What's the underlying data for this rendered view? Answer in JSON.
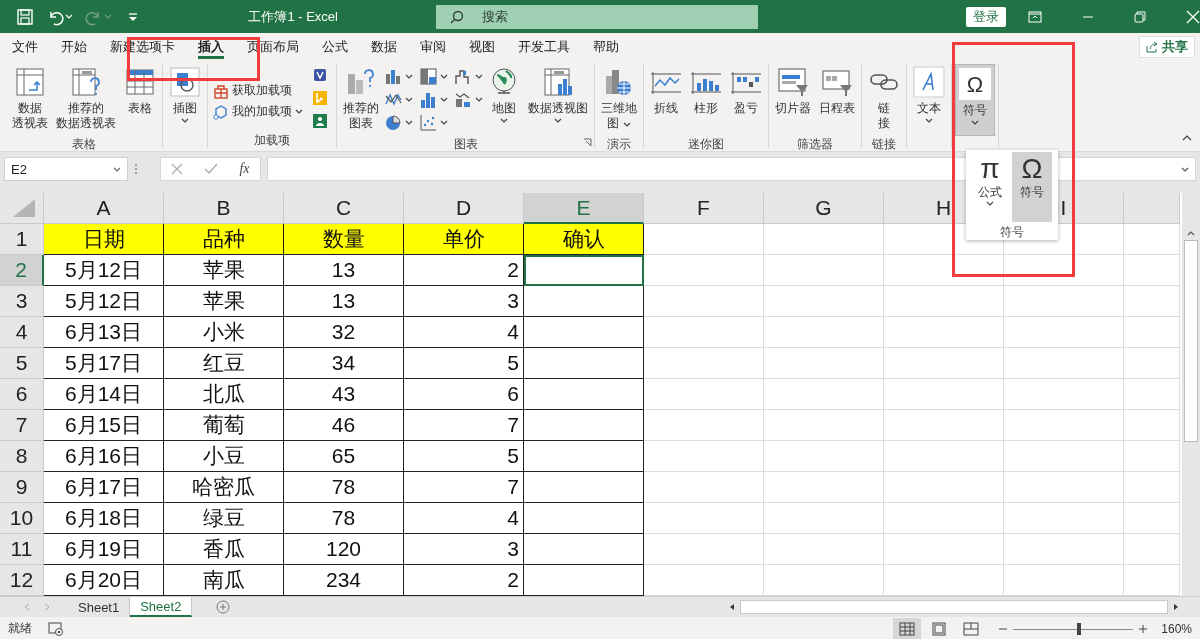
{
  "title_bar": {
    "quick_access": [
      {
        "kind": "save",
        "disabled": false
      },
      {
        "kind": "undo",
        "disabled": false
      },
      {
        "kind": "redo",
        "disabled": true
      },
      {
        "kind": "customize",
        "disabled": false
      }
    ],
    "title": "工作簿1 - Excel",
    "search": {
      "placeholder": "搜索"
    },
    "sign_in": "登录"
  },
  "tabs": [
    {
      "label": "文件",
      "selected": false
    },
    {
      "label": "开始",
      "selected": false
    },
    {
      "label": "新建选项卡",
      "selected": false
    },
    {
      "label": "插入",
      "selected": true
    },
    {
      "label": "页面布局",
      "selected": false
    },
    {
      "label": "公式",
      "selected": false
    },
    {
      "label": "数据",
      "selected": false
    },
    {
      "label": "审阅",
      "selected": false
    },
    {
      "label": "视图",
      "selected": false
    },
    {
      "label": "开发工具",
      "selected": false
    },
    {
      "label": "帮助",
      "selected": false
    }
  ],
  "share": "共享",
  "ribbon": [
    {
      "label": "表格",
      "items": [
        {
          "kind": "large",
          "lines": [
            "数据",
            "透视表"
          ]
        },
        {
          "kind": "large",
          "lines": [
            "推荐的",
            "数据透视表"
          ]
        },
        {
          "kind": "large",
          "lines": [
            "表格"
          ]
        }
      ]
    },
    {
      "items": [
        {
          "kind": "large",
          "lines": [
            "插图"
          ],
          "dropdown": true
        }
      ]
    },
    {
      "label": "加载项",
      "items": [
        {
          "kind": "small",
          "label": "获取加载项"
        },
        {
          "kind": "small",
          "label": "我的加载项",
          "dropdown": true
        },
        {
          "kind": "icon-stack"
        }
      ]
    },
    {
      "label": "图表",
      "launcher": true,
      "items": [
        {
          "kind": "large",
          "lines": [
            "推荐的",
            "图表"
          ]
        },
        {
          "kind": "gallery"
        },
        {
          "kind": "large",
          "lines": [
            "地图"
          ],
          "dropdown": true
        },
        {
          "kind": "large",
          "lines": [
            "数据透视图"
          ],
          "dropdown": true
        }
      ]
    },
    {
      "label": "演示",
      "items": [
        {
          "kind": "large",
          "lines": [
            "三维地",
            "图"
          ],
          "dropdown": true
        }
      ]
    },
    {
      "label": "迷你图",
      "items": [
        {
          "kind": "large",
          "lines": [
            "折线"
          ]
        },
        {
          "kind": "large",
          "lines": [
            "柱形"
          ]
        },
        {
          "kind": "large",
          "lines": [
            "盈亏"
          ]
        }
      ]
    },
    {
      "label": "筛选器",
      "items": [
        {
          "kind": "large",
          "lines": [
            "切片器"
          ]
        },
        {
          "kind": "large",
          "lines": [
            "日程表"
          ]
        }
      ]
    },
    {
      "label": "链接",
      "items": [
        {
          "kind": "large",
          "lines": [
            "链",
            "接"
          ]
        }
      ]
    },
    {
      "items": [
        {
          "kind": "large",
          "lines": [
            "文本"
          ],
          "dropdown": true
        }
      ]
    },
    {
      "items": [
        {
          "kind": "large",
          "lines": [
            "符号"
          ],
          "glyph": "Ω",
          "dropdown": true,
          "pressed": true
        }
      ]
    }
  ],
  "symbol_menu": {
    "items": [
      {
        "glyph": "π",
        "label": "公式",
        "dropdown": true,
        "selected": false
      },
      {
        "glyph": "Ω",
        "label": "符号",
        "selected": true
      }
    ],
    "group_label": "符号"
  },
  "formula_bar": {
    "name_box": "E2",
    "fx": "fx"
  },
  "table": {
    "columns": [
      {
        "label": "A",
        "selected": false
      },
      {
        "label": "B",
        "selected": false
      },
      {
        "label": "C",
        "selected": false
      },
      {
        "label": "D",
        "selected": false
      },
      {
        "label": "E",
        "selected": true
      },
      {
        "label": "F",
        "selected": false
      },
      {
        "label": "G",
        "selected": false
      },
      {
        "label": "H",
        "selected": false
      },
      {
        "label": "I",
        "selected": false
      }
    ],
    "rows": [
      {
        "number": "1",
        "selected": false,
        "color": "#ffff00",
        "cells": [
          "日期",
          "品种",
          "数量",
          "单价",
          "确认"
        ]
      },
      {
        "number": "2",
        "selected": true,
        "cells": [
          "5月12日",
          "苹果",
          "13",
          "2"
        ]
      },
      {
        "number": "3",
        "selected": false,
        "cells": [
          "5月12日",
          "苹果",
          "13",
          "3"
        ]
      },
      {
        "number": "4",
        "selected": false,
        "cells": [
          "6月13日",
          "小米",
          "32",
          "4"
        ]
      },
      {
        "number": "5",
        "selected": false,
        "cells": [
          "5月17日",
          "红豆",
          "34",
          "5"
        ]
      },
      {
        "number": "6",
        "selected": false,
        "cells": [
          "6月14日",
          "北瓜",
          "43",
          "6"
        ]
      },
      {
        "number": "7",
        "selected": false,
        "cells": [
          "6月15日",
          "葡萄",
          "46",
          "7"
        ]
      },
      {
        "number": "8",
        "selected": false,
        "cells": [
          "6月16日",
          "小豆",
          "65",
          "5"
        ]
      },
      {
        "number": "9",
        "selected": false,
        "cells": [
          "6月17日",
          "哈密瓜",
          "78",
          "7"
        ]
      },
      {
        "number": "10",
        "selected": false,
        "cells": [
          "6月18日",
          "绿豆",
          "78",
          "4"
        ]
      },
      {
        "number": "11",
        "selected": false,
        "cells": [
          "6月19日",
          "香瓜",
          "120",
          "3"
        ]
      },
      {
        "number": "12",
        "selected": false,
        "cells": [
          "6月20日",
          "南瓜",
          "234",
          "2"
        ]
      }
    ]
  },
  "sheets": [
    {
      "label": "Sheet1",
      "selected": false
    },
    {
      "label": "Sheet2",
      "selected": true
    }
  ],
  "status_bar": {
    "status": "就绪",
    "views": [
      {
        "kind": "normal",
        "selected": true
      },
      {
        "kind": "page-layout",
        "selected": false
      },
      {
        "kind": "page-break",
        "selected": false
      }
    ],
    "zoom": {
      "level": 0.55,
      "reading": "160%"
    }
  },
  "annotations": [
    {
      "kind": "frame"
    },
    {
      "kind": "frame"
    }
  ]
}
